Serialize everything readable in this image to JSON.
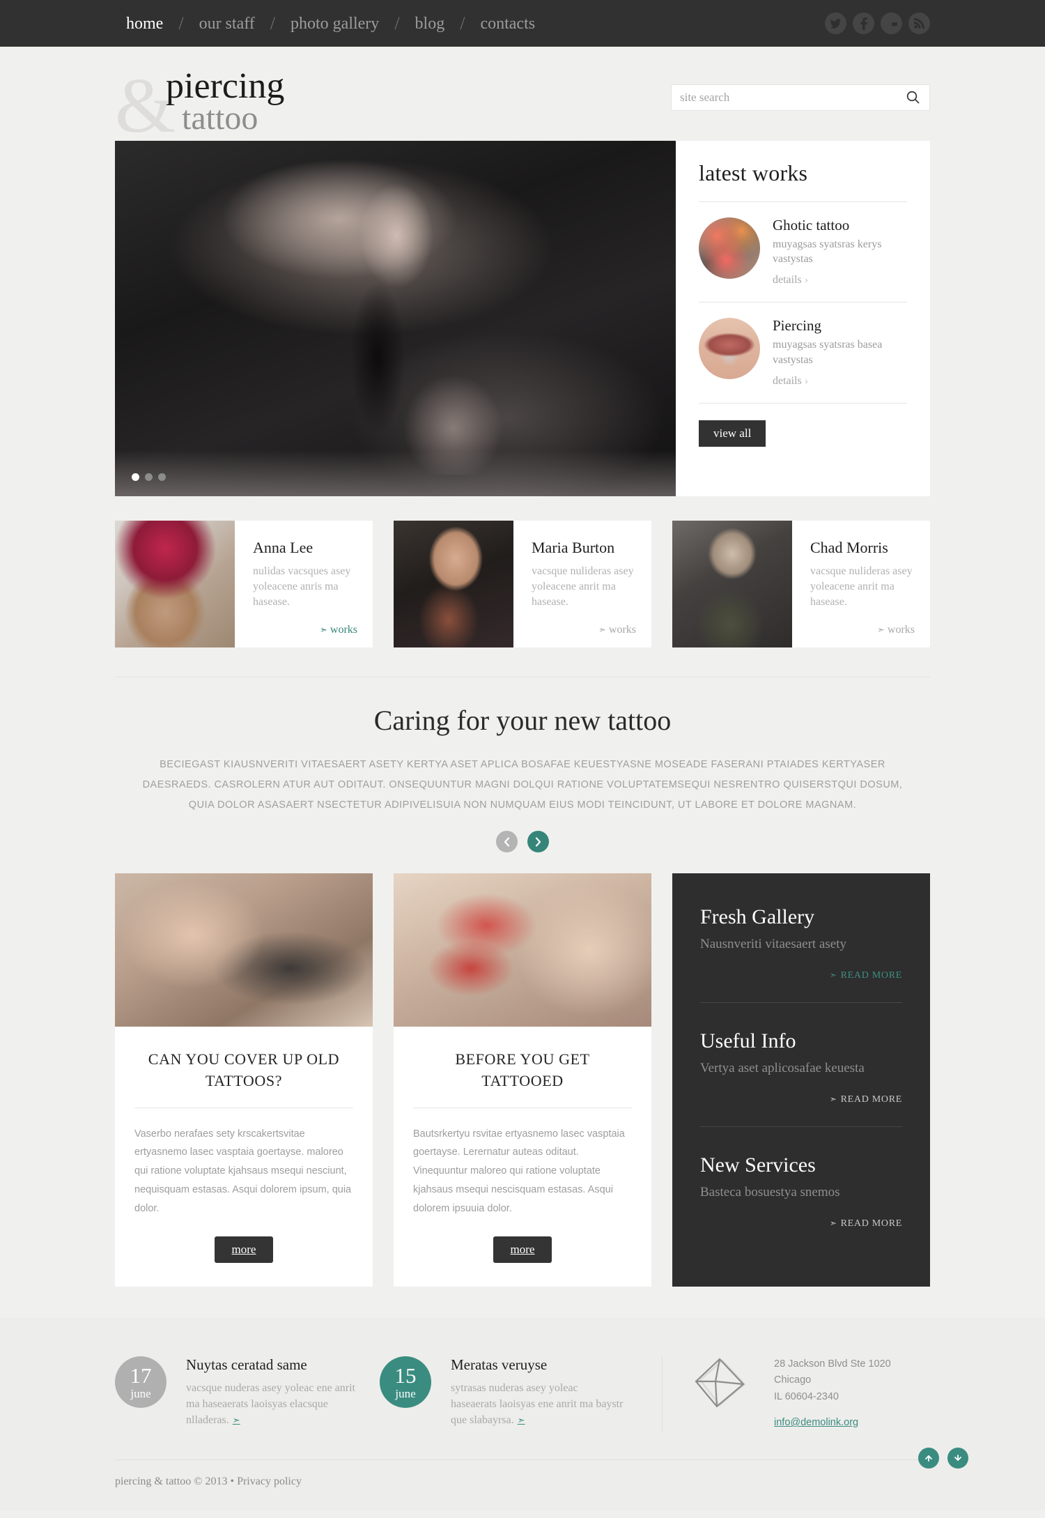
{
  "topnav": {
    "items": [
      {
        "label": "home",
        "active": true
      },
      {
        "label": "our staff",
        "active": false
      },
      {
        "label": "photo gallery",
        "active": false
      },
      {
        "label": "blog",
        "active": false
      },
      {
        "label": "contacts",
        "active": false
      }
    ],
    "separator": "/",
    "social": [
      "twitter-icon",
      "facebook-icon",
      "google-icon",
      "rss-icon"
    ]
  },
  "brand": {
    "amp": "&",
    "line1": "piercing",
    "line2": "tattoo"
  },
  "search": {
    "placeholder": "site search",
    "value": "",
    "icon": "search-icon"
  },
  "slider": {
    "dots": 3,
    "active_dot": 1
  },
  "latest": {
    "title": "latest works",
    "items": [
      {
        "name": "Ghotic tattoo",
        "desc": "muyagsas syatsras kerys vastystas",
        "link": "details",
        "chevron": "›"
      },
      {
        "name": "Piercing",
        "desc": "muyagsas syatsras basea vastystas",
        "link": "details",
        "chevron": "›"
      }
    ],
    "view_all": "view all"
  },
  "staff": [
    {
      "name": "Anna Lee",
      "desc": "nulidas vacsques asey yoleacene anris ma hasease.",
      "link": "works",
      "accent": true
    },
    {
      "name": "Maria Burton",
      "desc": "vacsque nulideras asey yoleacene anrit ma hasease.",
      "link": "works",
      "accent": false
    },
    {
      "name": "Chad Morris",
      "desc": "vacsque nulideras asey yoleacene anrit ma hasease.",
      "link": "works",
      "accent": false
    }
  ],
  "caring": {
    "title": "Caring for your new tattoo",
    "paragraph": "BECIEGAST KIAUSNVERITI VITAESAERT ASETY KERTYA ASET APLICA BOSAFAE KEUESTYASNE MOSEADE FASERANI PTAIADES KERTYASER DAESRAEDS. CASROLERN ATUR AUT ODITAUT. ONSEQUUNTUR MAGNI DOLQUI RATIONE VOLUPTATEMSEQUI NESRENTRO QUISERSTQUI DOSUM, QUIA DOLOR ASASAERT NSECTETUR ADIPIVELISUIA NON NUMQUAM EIUS MODI TEINCIDUNT, UT LABORE ET DOLORE MAGNAM.",
    "prev_icon": "chevron-left-icon",
    "next_icon": "chevron-right-icon"
  },
  "articles": [
    {
      "title": "CAN YOU COVER UP OLD TATTOOS?",
      "body": "Vaserbo nerafaes sety krscakertsvitae ertyasnemo lasec vasptaia goertayse. maloreo qui ratione voluptate kjahsaus msequi nesciunt, nequisquam estasas. Asqui dolorem ipsum, quia dolor.",
      "button": "more"
    },
    {
      "title": "BEFORE YOU GET TATTOOED",
      "body": "Bautsrkertyu rsvitae ertyasnemo lasec vasptaia goertayse. Lerernatur auteas oditaut. Vinequuntur maloreo qui ratione voluptate kjahsaus msequi nescisquam estasas. Asqui dolorem ipsuuia dolor.",
      "button": "more"
    }
  ],
  "promo": {
    "items": [
      {
        "title": "Fresh Gallery",
        "subtitle": "Nausnveriti vitaesaert asety",
        "link": "READ MORE",
        "accent": true
      },
      {
        "title": "Useful Info",
        "subtitle": "Vertya aset aplicosafae keuesta",
        "link": "READ MORE",
        "accent": false
      },
      {
        "title": "New Services",
        "subtitle": "Basteca bosuestya snemos",
        "link": "READ MORE",
        "accent": false
      }
    ],
    "arrow": "›"
  },
  "footer": {
    "news": [
      {
        "day": "17",
        "month": "june",
        "color": "#b0b0b0",
        "title": "Nuytas ceratad same",
        "text": "vacsque nuderas asey yoleac ene anrit ma haseaerats laoisyas elacsque nlladeras.",
        "arrow": "›"
      },
      {
        "day": "15",
        "month": "june",
        "color": "#3a8c80",
        "title": "Meratas veruyse",
        "text": "sytrasas nuderas asey yoleac haseaerats laoisyas ene anrit ma baystr que slabayrsa.",
        "arrow": "›"
      }
    ],
    "contact": {
      "icon": "envelope-icon",
      "line1": "28 Jackson Blvd Ste 1020",
      "line2": "Chicago",
      "line3": "IL 60604-2340",
      "email": "info@demolink.org"
    },
    "copyright": "piercing & tattoo © 2013",
    "dot": "•",
    "privacy": "Privacy policy",
    "scroll_up_icon": "arrow-up-icon",
    "scroll_down_icon": "arrow-down-icon"
  },
  "colors": {
    "accent": "#35857a",
    "dark": "#313131",
    "page_bg": "#f0f0ee"
  }
}
